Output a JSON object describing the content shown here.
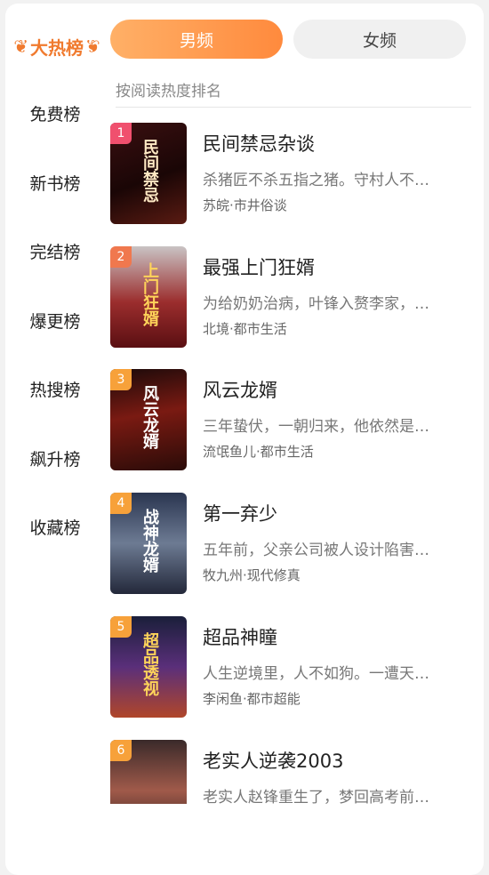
{
  "sidebar": {
    "title": "大热榜",
    "items": [
      "免费榜",
      "新书榜",
      "完结榜",
      "爆更榜",
      "热搜榜",
      "飙升榜",
      "收藏榜"
    ]
  },
  "tabs": {
    "male": "男频",
    "female": "女频"
  },
  "subheading": "按阅读热度排名",
  "books": [
    {
      "rank": "1",
      "title": "民间禁忌杂谈",
      "desc": "杀猪匠不杀五指之猪。守村人不…",
      "author": "苏皖",
      "category": "市井俗谈",
      "cover_text": "民间禁忌",
      "rank_color": "#f0506e"
    },
    {
      "rank": "2",
      "title": "最强上门狂婿",
      "desc": "为给奶奶治病，叶锋入赘李家，…",
      "author": "北境",
      "category": "都市生活",
      "cover_text": "上门狂婿",
      "rank_color": "#f0784e"
    },
    {
      "rank": "3",
      "title": "风云龙婿",
      "desc": "三年蛰伏，一朝归来，他依然是…",
      "author": "流氓鱼儿",
      "category": "都市生活",
      "cover_text": "风云龙婿",
      "rank_color": "#f7a13a"
    },
    {
      "rank": "4",
      "title": "第一弃少",
      "desc": "五年前，父亲公司被人设计陷害…",
      "author": "牧九州",
      "category": "现代修真",
      "cover_text": "战神龙婿",
      "rank_color": "#f7a13a"
    },
    {
      "rank": "5",
      "title": "超品神瞳",
      "desc": "人生逆境里，人不如狗。一遭天…",
      "author": "李闲鱼",
      "category": "都市超能",
      "cover_text": "超品透视",
      "rank_color": "#f7a13a"
    },
    {
      "rank": "6",
      "title": "老实人逆袭2003",
      "desc": "老实人赵锋重生了，梦回高考前…",
      "author": "",
      "category": "",
      "cover_text": "",
      "rank_color": "#f7a13a"
    }
  ],
  "colors": {
    "accent": "#f07a2e"
  }
}
